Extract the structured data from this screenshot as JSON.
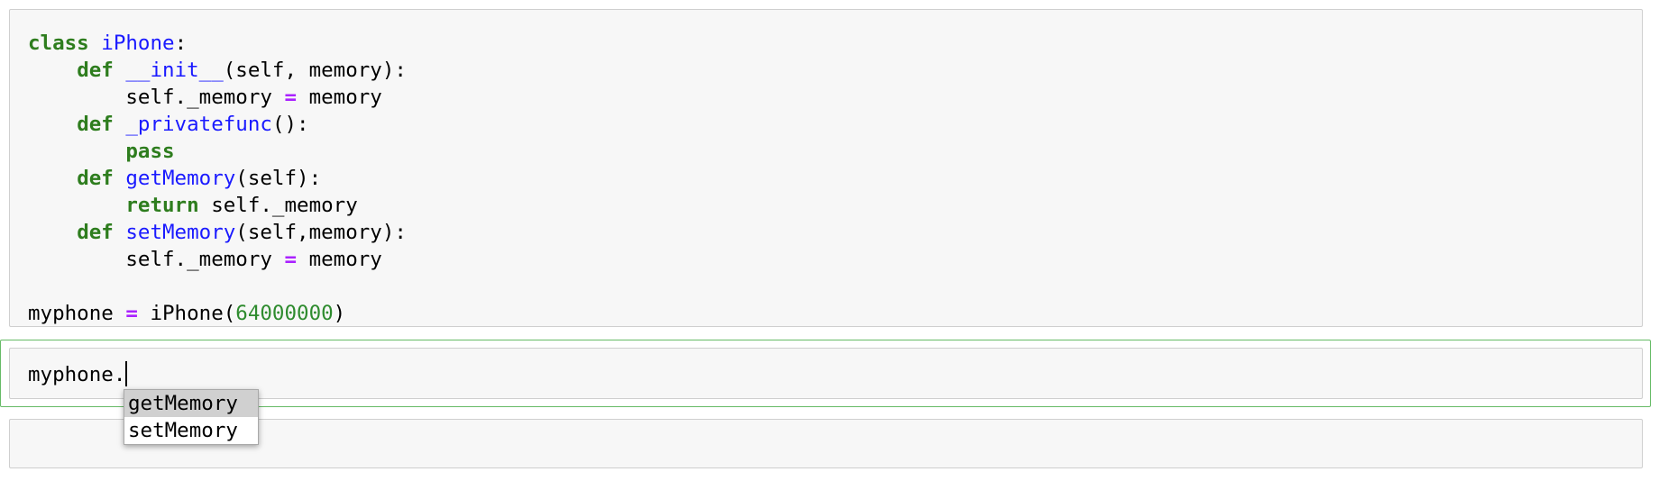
{
  "cells": [
    {
      "type": "code",
      "lines": [
        [
          {
            "t": "class",
            "c": "kw"
          },
          {
            "t": " "
          },
          {
            "t": "iPhone",
            "c": "nm"
          },
          {
            "t": ":"
          }
        ],
        [
          {
            "t": "    "
          },
          {
            "t": "def",
            "c": "kw"
          },
          {
            "t": " "
          },
          {
            "t": "__init__",
            "c": "nm"
          },
          {
            "t": "(self, memory):"
          }
        ],
        [
          {
            "t": "        self._memory "
          },
          {
            "t": "=",
            "c": "op"
          },
          {
            "t": " memory"
          }
        ],
        [
          {
            "t": "    "
          },
          {
            "t": "def",
            "c": "kw"
          },
          {
            "t": " "
          },
          {
            "t": "_privatefunc",
            "c": "nm"
          },
          {
            "t": "():"
          }
        ],
        [
          {
            "t": "        "
          },
          {
            "t": "pass",
            "c": "kw"
          }
        ],
        [
          {
            "t": "    "
          },
          {
            "t": "def",
            "c": "kw"
          },
          {
            "t": " "
          },
          {
            "t": "getMemory",
            "c": "nm"
          },
          {
            "t": "(self):"
          }
        ],
        [
          {
            "t": "        "
          },
          {
            "t": "return",
            "c": "kw"
          },
          {
            "t": " self._memory"
          }
        ],
        [
          {
            "t": "    "
          },
          {
            "t": "def",
            "c": "kw"
          },
          {
            "t": " "
          },
          {
            "t": "setMemory",
            "c": "nm"
          },
          {
            "t": "(self,memory):"
          }
        ],
        [
          {
            "t": "        self._memory "
          },
          {
            "t": "=",
            "c": "op"
          },
          {
            "t": " memory"
          }
        ],
        [],
        [
          {
            "t": "myphone "
          },
          {
            "t": "=",
            "c": "op"
          },
          {
            "t": " iPhone("
          },
          {
            "t": "64000000",
            "c": "num"
          },
          {
            "t": ")"
          }
        ]
      ]
    },
    {
      "type": "code",
      "input_text": "myphone.",
      "selected": true
    },
    {
      "type": "code",
      "input_text": ""
    }
  ],
  "completer": {
    "options": [
      "getMemory",
      "setMemory"
    ],
    "active_index": 0
  },
  "colors": {
    "keyword": "#2e7d1e",
    "name": "#1a1aff",
    "operator": "#aa22ff",
    "number": "#2e8b2e",
    "selected_border": "#66bb66",
    "cell_bg": "#f7f7f7"
  }
}
